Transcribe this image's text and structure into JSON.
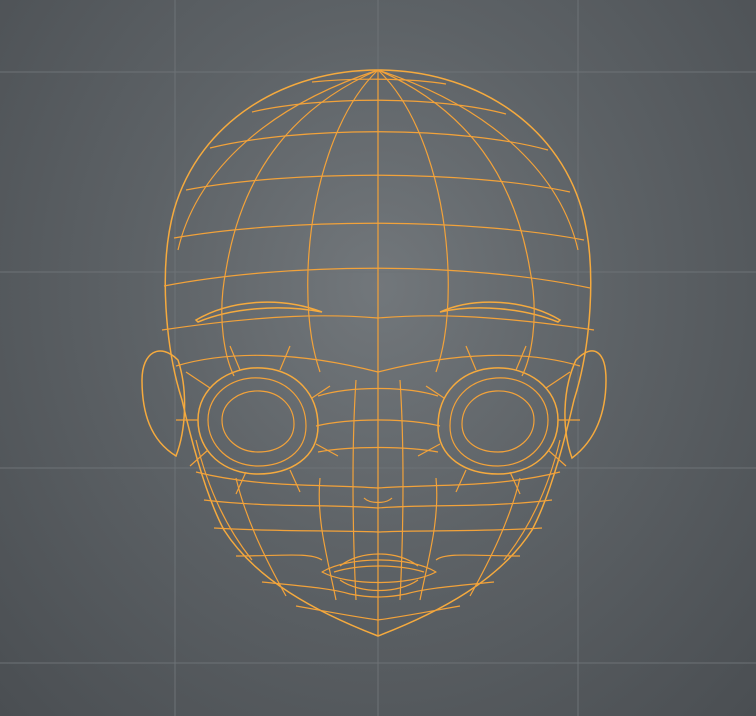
{
  "app": {
    "view": "3d-viewport"
  },
  "viewport": {
    "background_color": "#5d6266",
    "grid_color": "#6d7276",
    "mesh_color": "#d6d6d6",
    "wireframe_color": "#f2a23a",
    "object": "head-mesh-icon",
    "selection_state": "selected"
  }
}
